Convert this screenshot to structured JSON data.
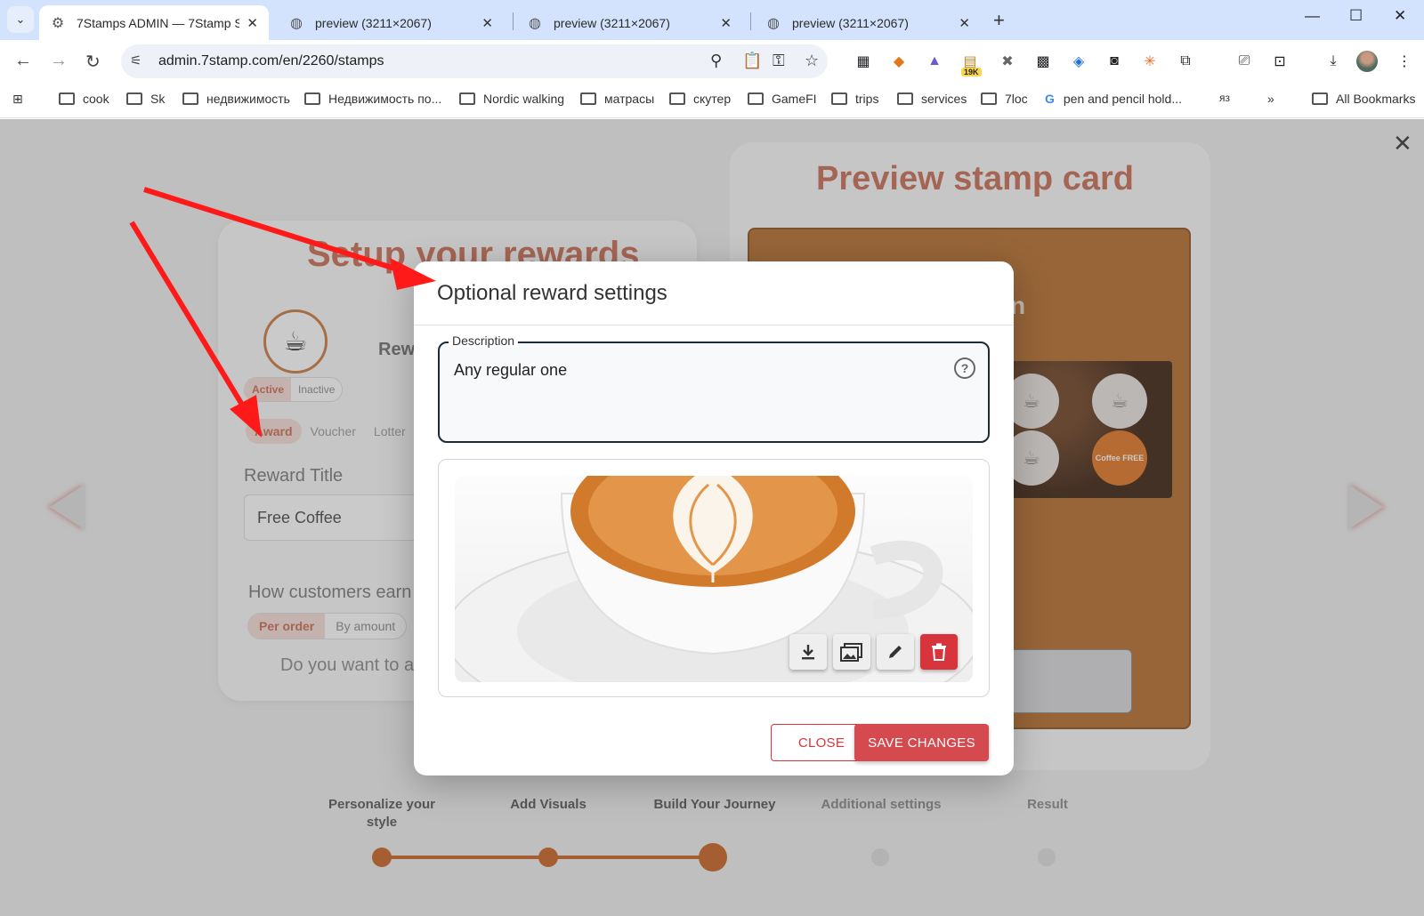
{
  "browser": {
    "tabs": [
      {
        "title": "7Stamps ADMIN — 7Stamp Sh",
        "active": true
      },
      {
        "title": "preview (3211×2067)",
        "active": false
      },
      {
        "title": "preview (3211×2067)",
        "active": false
      },
      {
        "title": "preview (3211×2067)",
        "active": false
      }
    ],
    "url": "admin.7stamp.com/en/2260/stamps",
    "extension_badge": "19K",
    "bookmarks": [
      "cook",
      "Sk",
      "недвижимость",
      "Недвижимость по...",
      "Nordic walking",
      "матрасы",
      "скутер",
      "GameFI",
      "trips",
      "services",
      "7loc",
      "pen and pencil hold...",
      "яз"
    ],
    "all_bookmarks_label": "All Bookmarks"
  },
  "page": {
    "setup_title": "Setup your rewards",
    "reward_label": "Rew",
    "status_toggle": {
      "active": "Active",
      "inactive": "Inactive"
    },
    "reward_types": [
      "Award",
      "Voucher",
      "Lotter"
    ],
    "reward_title_label": "Reward Title",
    "reward_title_value": "Free Coffee",
    "how_earn_label": "How customers earn",
    "earn_modes": [
      "Per order",
      "By amount"
    ],
    "do_you_want_label": "Do you want to a",
    "preview_title": "Preview stamp card",
    "preview_partial_text": "n",
    "stamp_free_text": "Coffee FREE"
  },
  "stepper": {
    "steps": [
      {
        "label": "Personalize your style",
        "done": true
      },
      {
        "label": "Add Visuals",
        "done": true
      },
      {
        "label": "Build Your Journey",
        "done": true,
        "current": true
      },
      {
        "label": "Additional settings",
        "done": false
      },
      {
        "label": "Result",
        "done": false
      }
    ]
  },
  "modal": {
    "title": "Optional reward settings",
    "description_label": "Description",
    "description_value": "Any regular one",
    "image_actions": [
      "download-icon",
      "gallery-icon",
      "edit-icon",
      "delete-icon"
    ],
    "close_label": "CLOSE",
    "save_label": "SAVE CHANGES"
  },
  "colors": {
    "accent": "#d54a4f",
    "brand_orange": "#c9601e",
    "tabstrip": "#d3e3fd",
    "annotation_arrow": "#ff1a1a"
  }
}
